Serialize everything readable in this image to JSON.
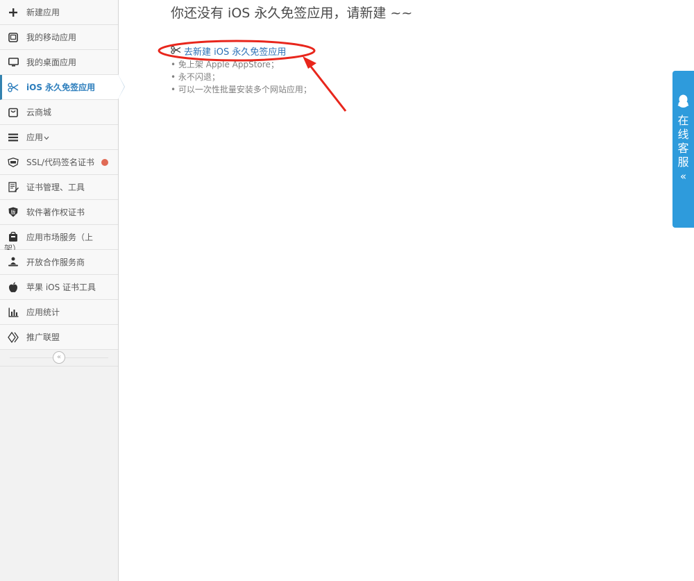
{
  "sidebar": {
    "items": [
      {
        "id": "new-app",
        "label": "新建应用",
        "icon": "plus-icon"
      },
      {
        "id": "mobile-apps",
        "label": "我的移动应用",
        "icon": "tablet-icon"
      },
      {
        "id": "desktop-apps",
        "label": "我的桌面应用",
        "icon": "desktop-icon"
      },
      {
        "id": "ios-free-sign",
        "label": "iOS 永久免签应用",
        "icon": "scissors-icon"
      },
      {
        "id": "cloud-store",
        "label": "云商城",
        "icon": "shopping-bag-icon"
      },
      {
        "id": "apps",
        "label": "应用",
        "icon": "list-icon"
      },
      {
        "id": "ssl-cert",
        "label": "SSL/代码签名证书",
        "icon": "shield-cert-icon"
      },
      {
        "id": "cert-tools",
        "label": "证书管理、工具",
        "icon": "document-edit-icon"
      },
      {
        "id": "software-copyright",
        "label": "软件著作权证书",
        "icon": "copyright-shield-icon"
      },
      {
        "id": "market-service",
        "label": "应用市场服务（上",
        "label_overflow": "架）",
        "icon": "market-bag-icon"
      },
      {
        "id": "partner",
        "label": "开放合作服务商",
        "icon": "partner-icon"
      },
      {
        "id": "apple-ios-cert",
        "label": "苹果 iOS 证书工具",
        "icon": "apple-icon"
      },
      {
        "id": "app-stats",
        "label": "应用统计",
        "icon": "bar-chart-icon"
      },
      {
        "id": "affiliate",
        "label": "推广联盟",
        "icon": "diamond-link-icon"
      }
    ],
    "collapse_glyph": "«"
  },
  "main": {
    "empty_title": "你还没有 iOS 永久免签应用，请新建 ~~",
    "create_link": "去新建 iOS 永久免签应用",
    "features": [
      "• 免上架 Apple AppStore；",
      "• 永不闪退；",
      "• 可以一次性批量安装多个网站应用；"
    ]
  },
  "kefu": {
    "text": "在线客服",
    "arrow": "«"
  },
  "colors": {
    "active_nav": "#2b7dbc",
    "link": "#2a6fb5",
    "kefu_bg": "#2e9bdc",
    "annotation_red": "#e8261c",
    "badge_dot": "#e06a55"
  }
}
